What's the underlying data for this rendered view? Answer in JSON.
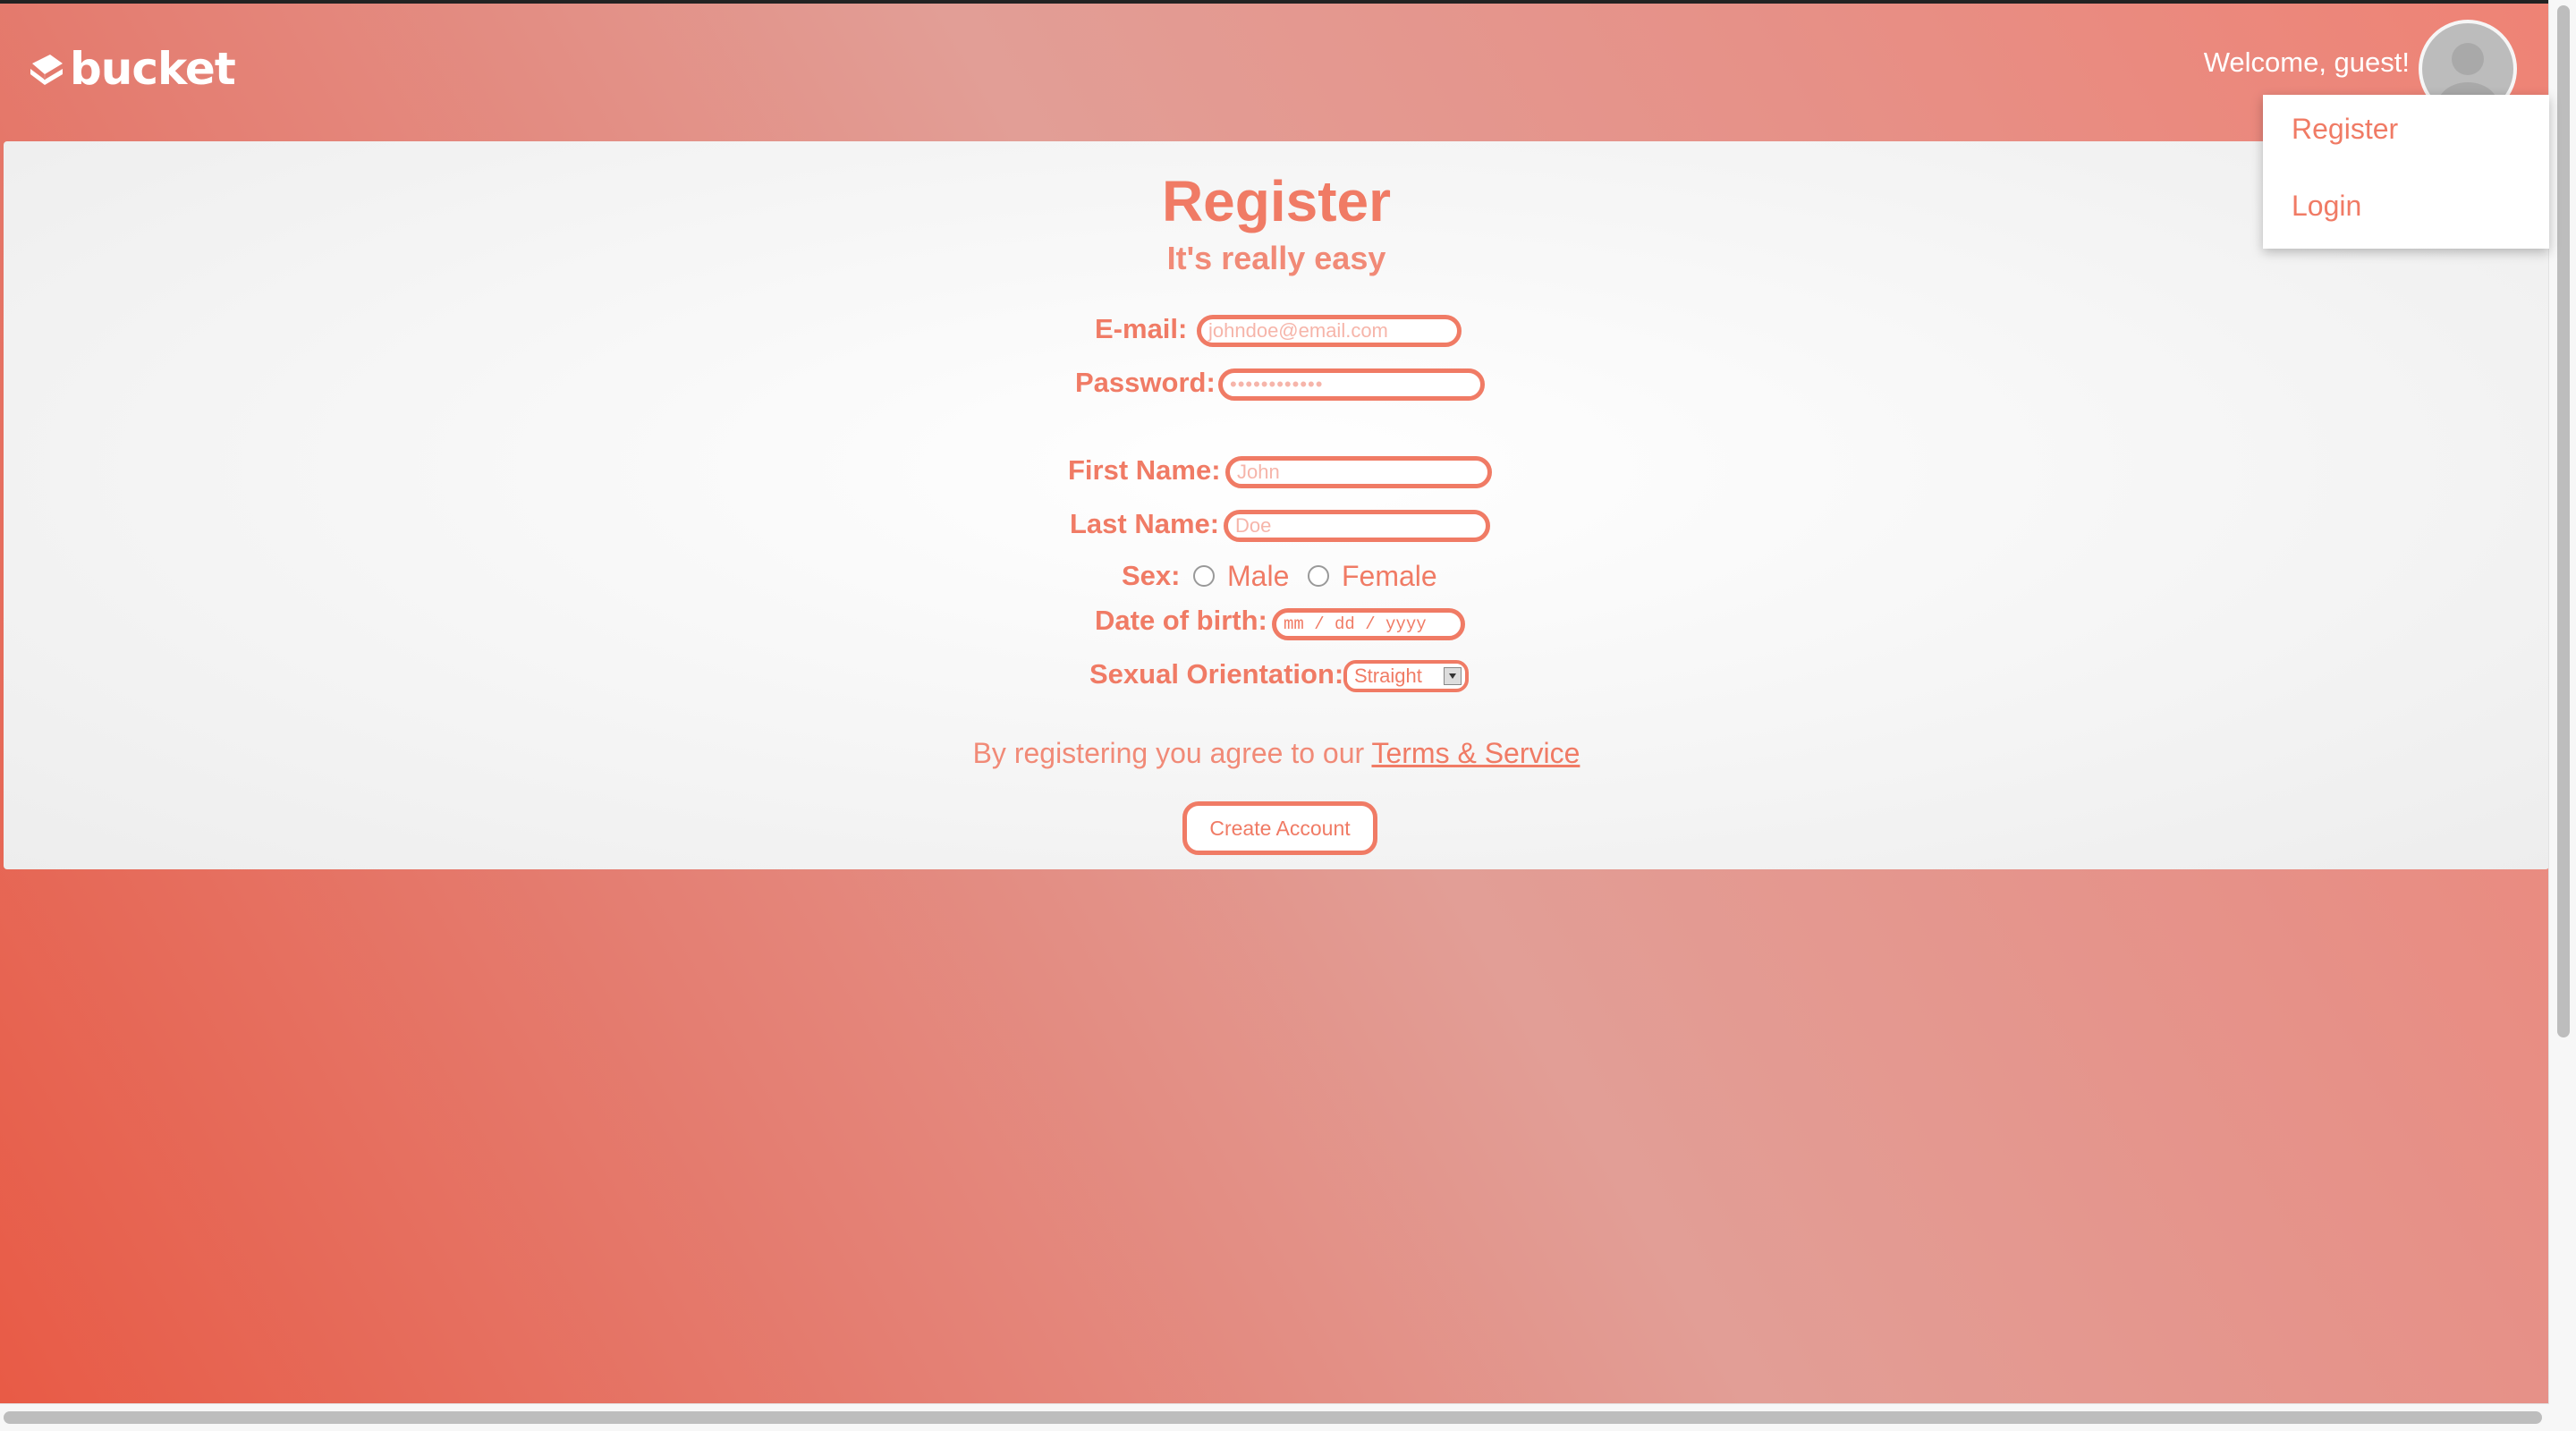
{
  "header": {
    "logo_text": "bucket",
    "welcome": "Welcome, guest!"
  },
  "dropdown": {
    "items": [
      "Register",
      "Login"
    ]
  },
  "page": {
    "title": "Register",
    "subtitle": "It's really easy"
  },
  "form": {
    "email_label": "E-mail:",
    "email_placeholder": "johndoe@email.com",
    "password_label": "Password:",
    "password_placeholder": "••••••••••••",
    "first_name_label": "First Name:",
    "first_name_placeholder": "John",
    "last_name_label": "Last Name:",
    "last_name_placeholder": "Doe",
    "sex_label": "Sex:",
    "sex_options": [
      "Male",
      "Female"
    ],
    "dob_label": "Date of birth:",
    "dob_placeholder": "mm / dd / yyyy",
    "orientation_label": "Sexual Orientation:",
    "orientation_value": "Straight"
  },
  "terms": {
    "text": "By registering you agree to our ",
    "link": "Terms & Service"
  },
  "submit_label": "Create Account"
}
